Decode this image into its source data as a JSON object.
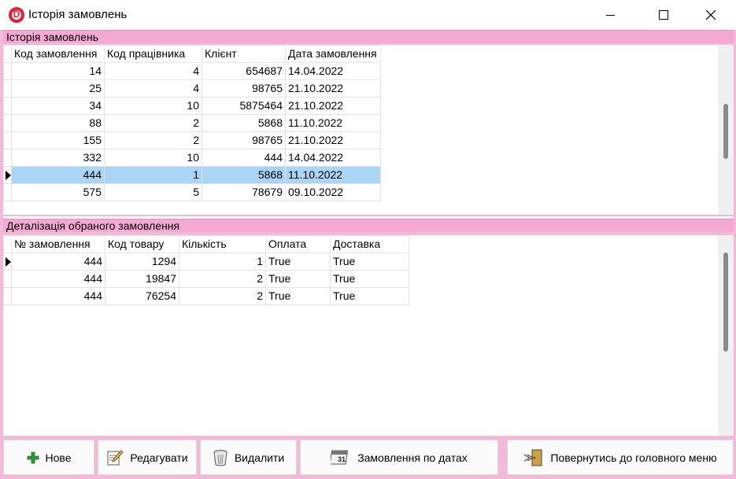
{
  "window": {
    "title": "Історія замовлень",
    "app_icon_letter": "D"
  },
  "orders_panel": {
    "header": "Історія замовлень",
    "columns": [
      "Код замовлення",
      "Код працівника",
      "Клієнт",
      "Дата замовлення"
    ],
    "rows": [
      [
        "14",
        "4",
        "654687",
        "14.04.2022"
      ],
      [
        "25",
        "4",
        "98765",
        "21.10.2022"
      ],
      [
        "34",
        "10",
        "5875464",
        "21.10.2022"
      ],
      [
        "88",
        "2",
        "5868",
        "11.10.2022"
      ],
      [
        "155",
        "2",
        "98765",
        "21.10.2022"
      ],
      [
        "332",
        "10",
        "444",
        "14.04.2022"
      ],
      [
        "444",
        "1",
        "5868",
        "11.10.2022"
      ],
      [
        "575",
        "5",
        "78679",
        "09.10.2022"
      ]
    ],
    "selected_row_index": 6
  },
  "details_panel": {
    "header": "Деталізація обраного замовлення",
    "columns": [
      "№ замовлення",
      "Код товару",
      "Кількість",
      "Оплата",
      "Доставка"
    ],
    "rows": [
      [
        "444",
        "1294",
        "1",
        "True",
        "True"
      ],
      [
        "444",
        "19847",
        "2",
        "True",
        "True"
      ],
      [
        "444",
        "76254",
        "2",
        "True",
        "True"
      ]
    ],
    "current_row_index": 0
  },
  "toolbar": {
    "new_label": "Нове",
    "edit_label": "Редагувати",
    "delete_label": "Видалити",
    "by_dates_label": "Замовлення по датах",
    "back_label": "Повернутись до головного меню",
    "calendar_icon_day": "31"
  },
  "colors": {
    "accent_pink": "#f4a9d2",
    "selection_blue": "#aad5f5",
    "logo_red": "#e51f2e"
  }
}
